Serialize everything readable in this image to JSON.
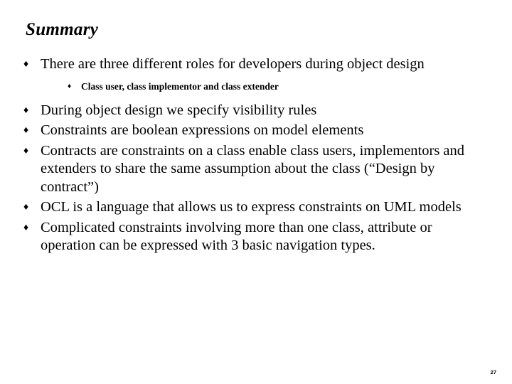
{
  "slide": {
    "title": "Summary",
    "page_number": "27",
    "bullet_marker": "♦",
    "sub_bullet_marker": "♦",
    "background_color": "#ffffff",
    "text_color": "#000000",
    "bullets": [
      {
        "text": "There are three different  roles for  developers during object design",
        "sub_bullets": [
          {
            "text": "Class user, class implementor and class extender"
          }
        ]
      },
      {
        "text": "During object design we specify visibility rules",
        "sub_bullets": []
      },
      {
        "text": "Constraints are boolean expressions on model elements",
        "sub_bullets": []
      },
      {
        "text": "Contracts are constraints on a class enable class users, implementors and extenders to share the same assumption about the class (“Design by contract”)",
        "sub_bullets": []
      },
      {
        "text": "OCL is a language that allows us to express constraints on UML models",
        "sub_bullets": []
      },
      {
        "text": "Complicated constraints involving more than one class, attribute or operation can be expressed with 3 basic navigation types.",
        "sub_bullets": []
      }
    ]
  }
}
